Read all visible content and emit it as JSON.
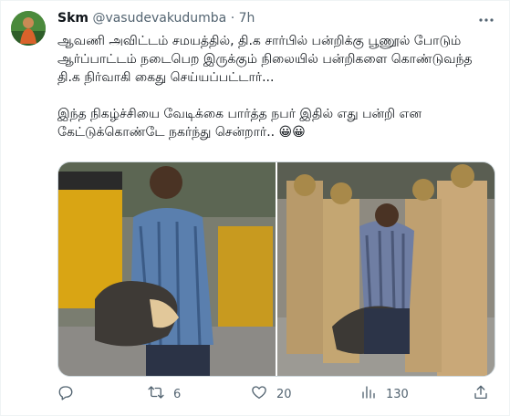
{
  "tweet": {
    "author_name": "Skm",
    "handle": "@vasudevakudumba",
    "separator": "·",
    "time": "7h",
    "text": "ஆவணி அவிட்டம் சமயத்தில், தி.க சார்பில் பன்றிக்கு பூணூல் போடும் ஆர்ப்பாட்டம் நடைபெற இருக்கும் நிலையில் பன்றிகளை கொண்டுவந்த தி.க நிர்வாகி கைது செய்யப்பட்டார்...\n\nஇந்த நிகழ்ச்சியை வேடிக்கை பார்த்த நபர் இதில் எது பன்றி என கேட்டுக்கொண்டே நகர்ந்து சென்றார்.. 😀😀"
  },
  "actions": {
    "reply_count": "",
    "retweet_count": "6",
    "like_count": "20",
    "view_count": "130"
  },
  "icons": {
    "reply": "reply-icon",
    "retweet": "retweet-icon",
    "like": "heart-icon",
    "views": "views-icon",
    "share": "share-icon",
    "more": "more-icon"
  },
  "colors": {
    "icon_gray": "#536471",
    "border": "#eff3f4"
  }
}
